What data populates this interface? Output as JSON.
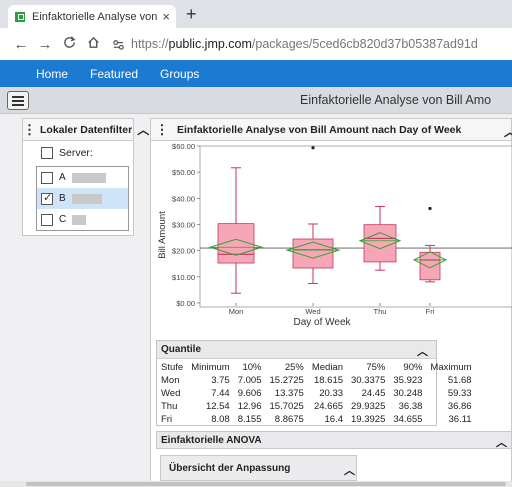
{
  "browser": {
    "tab_title": "Einfaktorielle Analyse von Bill Am",
    "tab_close": "×",
    "new_tab": "+",
    "url_scheme": "https://",
    "url_host": "public.jmp.com",
    "url_path": "/packages/5ced6cb820d37b05387ad91d"
  },
  "nav": {
    "items": [
      "Home",
      "Featured",
      "Groups"
    ]
  },
  "header": {
    "title": "Einfaktorielle Analyse von Bill Amo"
  },
  "filter": {
    "title": "Lokaler Datenfilter",
    "server_label": "Server:",
    "items": [
      {
        "label": "A",
        "checked": false
      },
      {
        "label": "B",
        "checked": true
      },
      {
        "label": "C",
        "checked": false
      }
    ]
  },
  "report": {
    "title": "Einfaktorielle Analyse von Bill Amount nach Day of Week"
  },
  "chart_data": {
    "type": "box",
    "xlabel": "Day of Week",
    "ylabel": "Bill Amount",
    "categories": [
      "Mon",
      "Wed",
      "Thu",
      "Fri"
    ],
    "y_ticks": [
      "$0.00",
      "$10.00",
      "$20.00",
      "$30.00",
      "$40.00",
      "$50.00",
      "$60.00"
    ],
    "ylim": [
      0,
      60
    ],
    "boxes": [
      {
        "name": "Mon",
        "min": 3.75,
        "q1": 15.2725,
        "median": 18.615,
        "q3": 30.3375,
        "max": 51.68,
        "mean": 21.3
      },
      {
        "name": "Wed",
        "min": 7.44,
        "q1": 13.375,
        "median": 20.33,
        "q3": 24.45,
        "max": 30.2,
        "mean": 20.2,
        "outliers": [
          59.33
        ]
      },
      {
        "name": "Thu",
        "min": 12.54,
        "q1": 15.7025,
        "median": 24.665,
        "q3": 29.9325,
        "max": 36.86,
        "mean": 23.8
      },
      {
        "name": "Fri",
        "min": 8.08,
        "q1": 8.8675,
        "median": 16.4,
        "q3": 19.3925,
        "max": 22.0,
        "mean": 16.5,
        "outliers": [
          36.11
        ]
      }
    ],
    "grand_mean": 21.0,
    "colors": {
      "box": "#f7a6b7",
      "box_stroke": "#c0395a",
      "diamond": "#36a336",
      "gridline": "#555555"
    }
  },
  "quantiles": {
    "title": "Quantile",
    "columns": [
      "Stufe",
      "Minimum",
      "10%",
      "25%",
      "Median",
      "75%",
      "90%",
      "Maximum"
    ],
    "rows": [
      [
        "Mon",
        "3.75",
        "7.005",
        "15.2725",
        "18.615",
        "30.3375",
        "35.923",
        "51.68"
      ],
      [
        "Wed",
        "7.44",
        "9.606",
        "13.375",
        "20.33",
        "24.45",
        "30.248",
        "59.33"
      ],
      [
        "Thu",
        "12.54",
        "12.96",
        "15.7025",
        "24.665",
        "29.9325",
        "36.38",
        "36.86"
      ],
      [
        "Fri",
        "8.08",
        "8.155",
        "8.8675",
        "16.4",
        "19.3925",
        "34.655",
        "36.11"
      ]
    ]
  },
  "anova": {
    "title": "Einfaktorielle ANOVA",
    "fit_title": "Übersicht der Anpassung"
  }
}
